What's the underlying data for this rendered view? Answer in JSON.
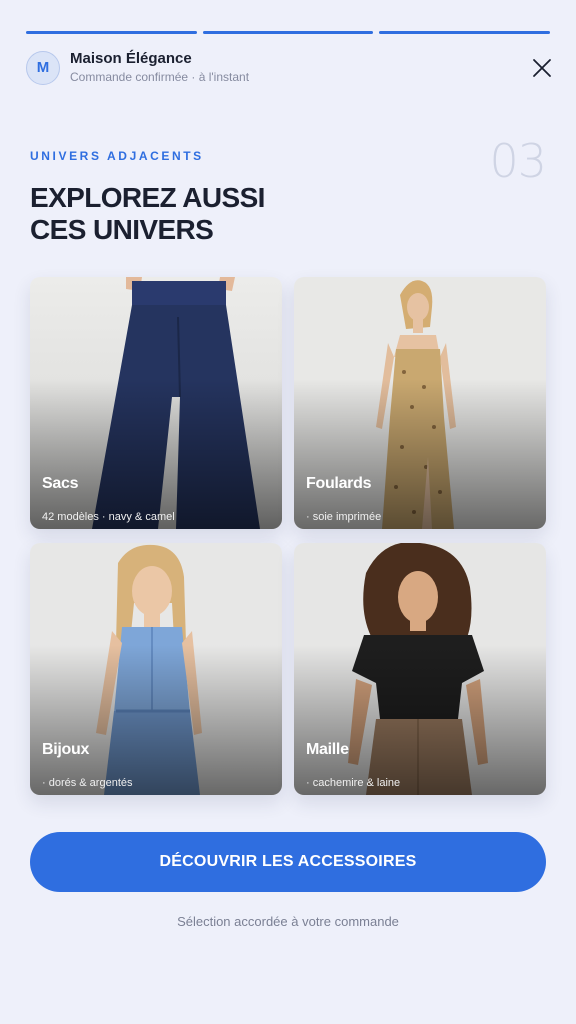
{
  "progress": {
    "segments": 3,
    "completed": 3
  },
  "header": {
    "avatar_initial": "M",
    "brand": "Maison Élégance",
    "subtitle": "Commande confirmée · à l'instant"
  },
  "section": {
    "eyebrow": "UNIVERS ADJACENTS",
    "step": "03",
    "title_line1": "EXPLOREZ AUSSI",
    "title_line2": "CES UNIVERS"
  },
  "categories": [
    {
      "label": "Sacs",
      "desc": "42 modèles · navy & camel",
      "image": "navy wide-leg trousers"
    },
    {
      "label": "Foulards",
      "desc": "· soie imprimée",
      "image": "woman in floral slip dress"
    },
    {
      "label": "Bijoux",
      "desc": "· dorés & argentés",
      "image": "woman in blue denim jumpsuit"
    },
    {
      "label": "Maille",
      "desc": "· cachemire & laine",
      "image": "woman in black top and camel skirt"
    }
  ],
  "cta": {
    "label": "DÉCOUVRIR LES ACCESSOIRES"
  },
  "footnote": "Sélection accordée à votre commande",
  "colors": {
    "accent": "#2f6ee0",
    "background": "#eef0fa",
    "title": "#1b2030"
  }
}
